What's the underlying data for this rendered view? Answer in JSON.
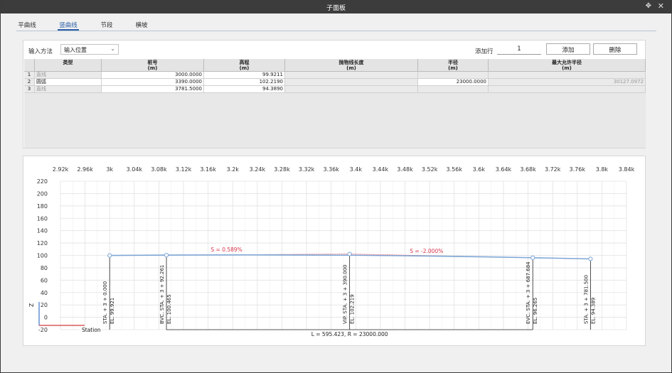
{
  "window": {
    "title": "子面板"
  },
  "tabs": [
    {
      "label": "平曲线"
    },
    {
      "label": "竖曲线"
    },
    {
      "label": "节段"
    },
    {
      "label": "横坡"
    }
  ],
  "input_method": {
    "label": "输入方法",
    "value": "输入位置"
  },
  "add_rows": {
    "label": "添加行",
    "value": "1"
  },
  "buttons": {
    "add": "添加",
    "delete": "删除"
  },
  "table": {
    "headers": [
      {
        "name": "类型",
        "unit": ""
      },
      {
        "name": "桩号",
        "unit": "(m)"
      },
      {
        "name": "高程",
        "unit": "(m)"
      },
      {
        "name": "抛物线长度",
        "unit": "(m)"
      },
      {
        "name": "半径",
        "unit": "(m)"
      },
      {
        "name": "最大允许半径",
        "unit": "(m)"
      }
    ],
    "rows": [
      {
        "index": "1",
        "type": "直线",
        "station": "3000.0000",
        "elevation": "99.9211",
        "parabola": "",
        "radius": "",
        "max_radius": ""
      },
      {
        "index": "2",
        "type": "圆弧",
        "station": "3390.0000",
        "elevation": "102.2190",
        "parabola": "",
        "radius": "23000.0000",
        "max_radius": "30127.0972"
      },
      {
        "index": "3",
        "type": "直线",
        "station": "3781.5000",
        "elevation": "94.3890",
        "parabola": "",
        "radius": "",
        "max_radius": ""
      }
    ]
  },
  "chart_data": {
    "type": "line",
    "x_tick_labels": [
      "2.92k",
      "2.96k",
      "3k",
      "3.04k",
      "3.08k",
      "3.12k",
      "3.16k",
      "3.2k",
      "3.24k",
      "3.28k",
      "3.32k",
      "3.36k",
      "3.4k",
      "3.44k",
      "3.48k",
      "3.52k",
      "3.56k",
      "3.6k",
      "3.64k",
      "3.68k",
      "3.72k",
      "3.76k",
      "3.8k",
      "3.84k"
    ],
    "y_tick_labels": [
      "220",
      "200",
      "180",
      "160",
      "140",
      "120",
      "100",
      "80",
      "60",
      "40",
      "20",
      "0",
      "-20"
    ],
    "xlim": [
      2920,
      3840
    ],
    "ylim": [
      -20,
      220
    ],
    "grid": true,
    "profile": [
      {
        "x": 3000,
        "y": 99.921
      },
      {
        "x": 3092.261,
        "y": 100.465
      },
      {
        "x": 3390,
        "y": 102.219
      },
      {
        "x": 3687.684,
        "y": 96.265
      },
      {
        "x": 3781.5,
        "y": 94.389
      }
    ],
    "points": [
      {
        "x": 3000,
        "y": 99.921,
        "label_sta": "STA. + 3 + 0.000",
        "label_el": "EL. 99.921"
      },
      {
        "x": 3092.261,
        "y": 100.465,
        "label_sta": "BVC. STA. + 3 + 92.261",
        "label_el": "EL. 100.465"
      },
      {
        "x": 3390,
        "y": 102.219,
        "label_sta": "VIP. STA. + 3 + 390.000",
        "label_el": "EL. 102.219"
      },
      {
        "x": 3687.684,
        "y": 96.265,
        "label_sta": "EVC. STA. + 3 + 687.684",
        "label_el": "EL. 96.265"
      },
      {
        "x": 3781.5,
        "y": 94.389,
        "label_sta": "STA. + 3 + 781.500",
        "label_el": "EL. 94.389"
      }
    ],
    "grade_labels": [
      {
        "x": 3190,
        "y": 104,
        "text": "S = 0.589%"
      },
      {
        "x": 3515,
        "y": 102,
        "text": "S = -2.000%"
      }
    ],
    "curve_label": "L = 595.423, R = 23000.000",
    "axis_z": "Z",
    "axis_station": "Station",
    "colors": {
      "profile": "#7ea6d6",
      "grade_text": "#d9344a",
      "tangent": "#d9344a",
      "grid": "#e2e2e2"
    }
  }
}
